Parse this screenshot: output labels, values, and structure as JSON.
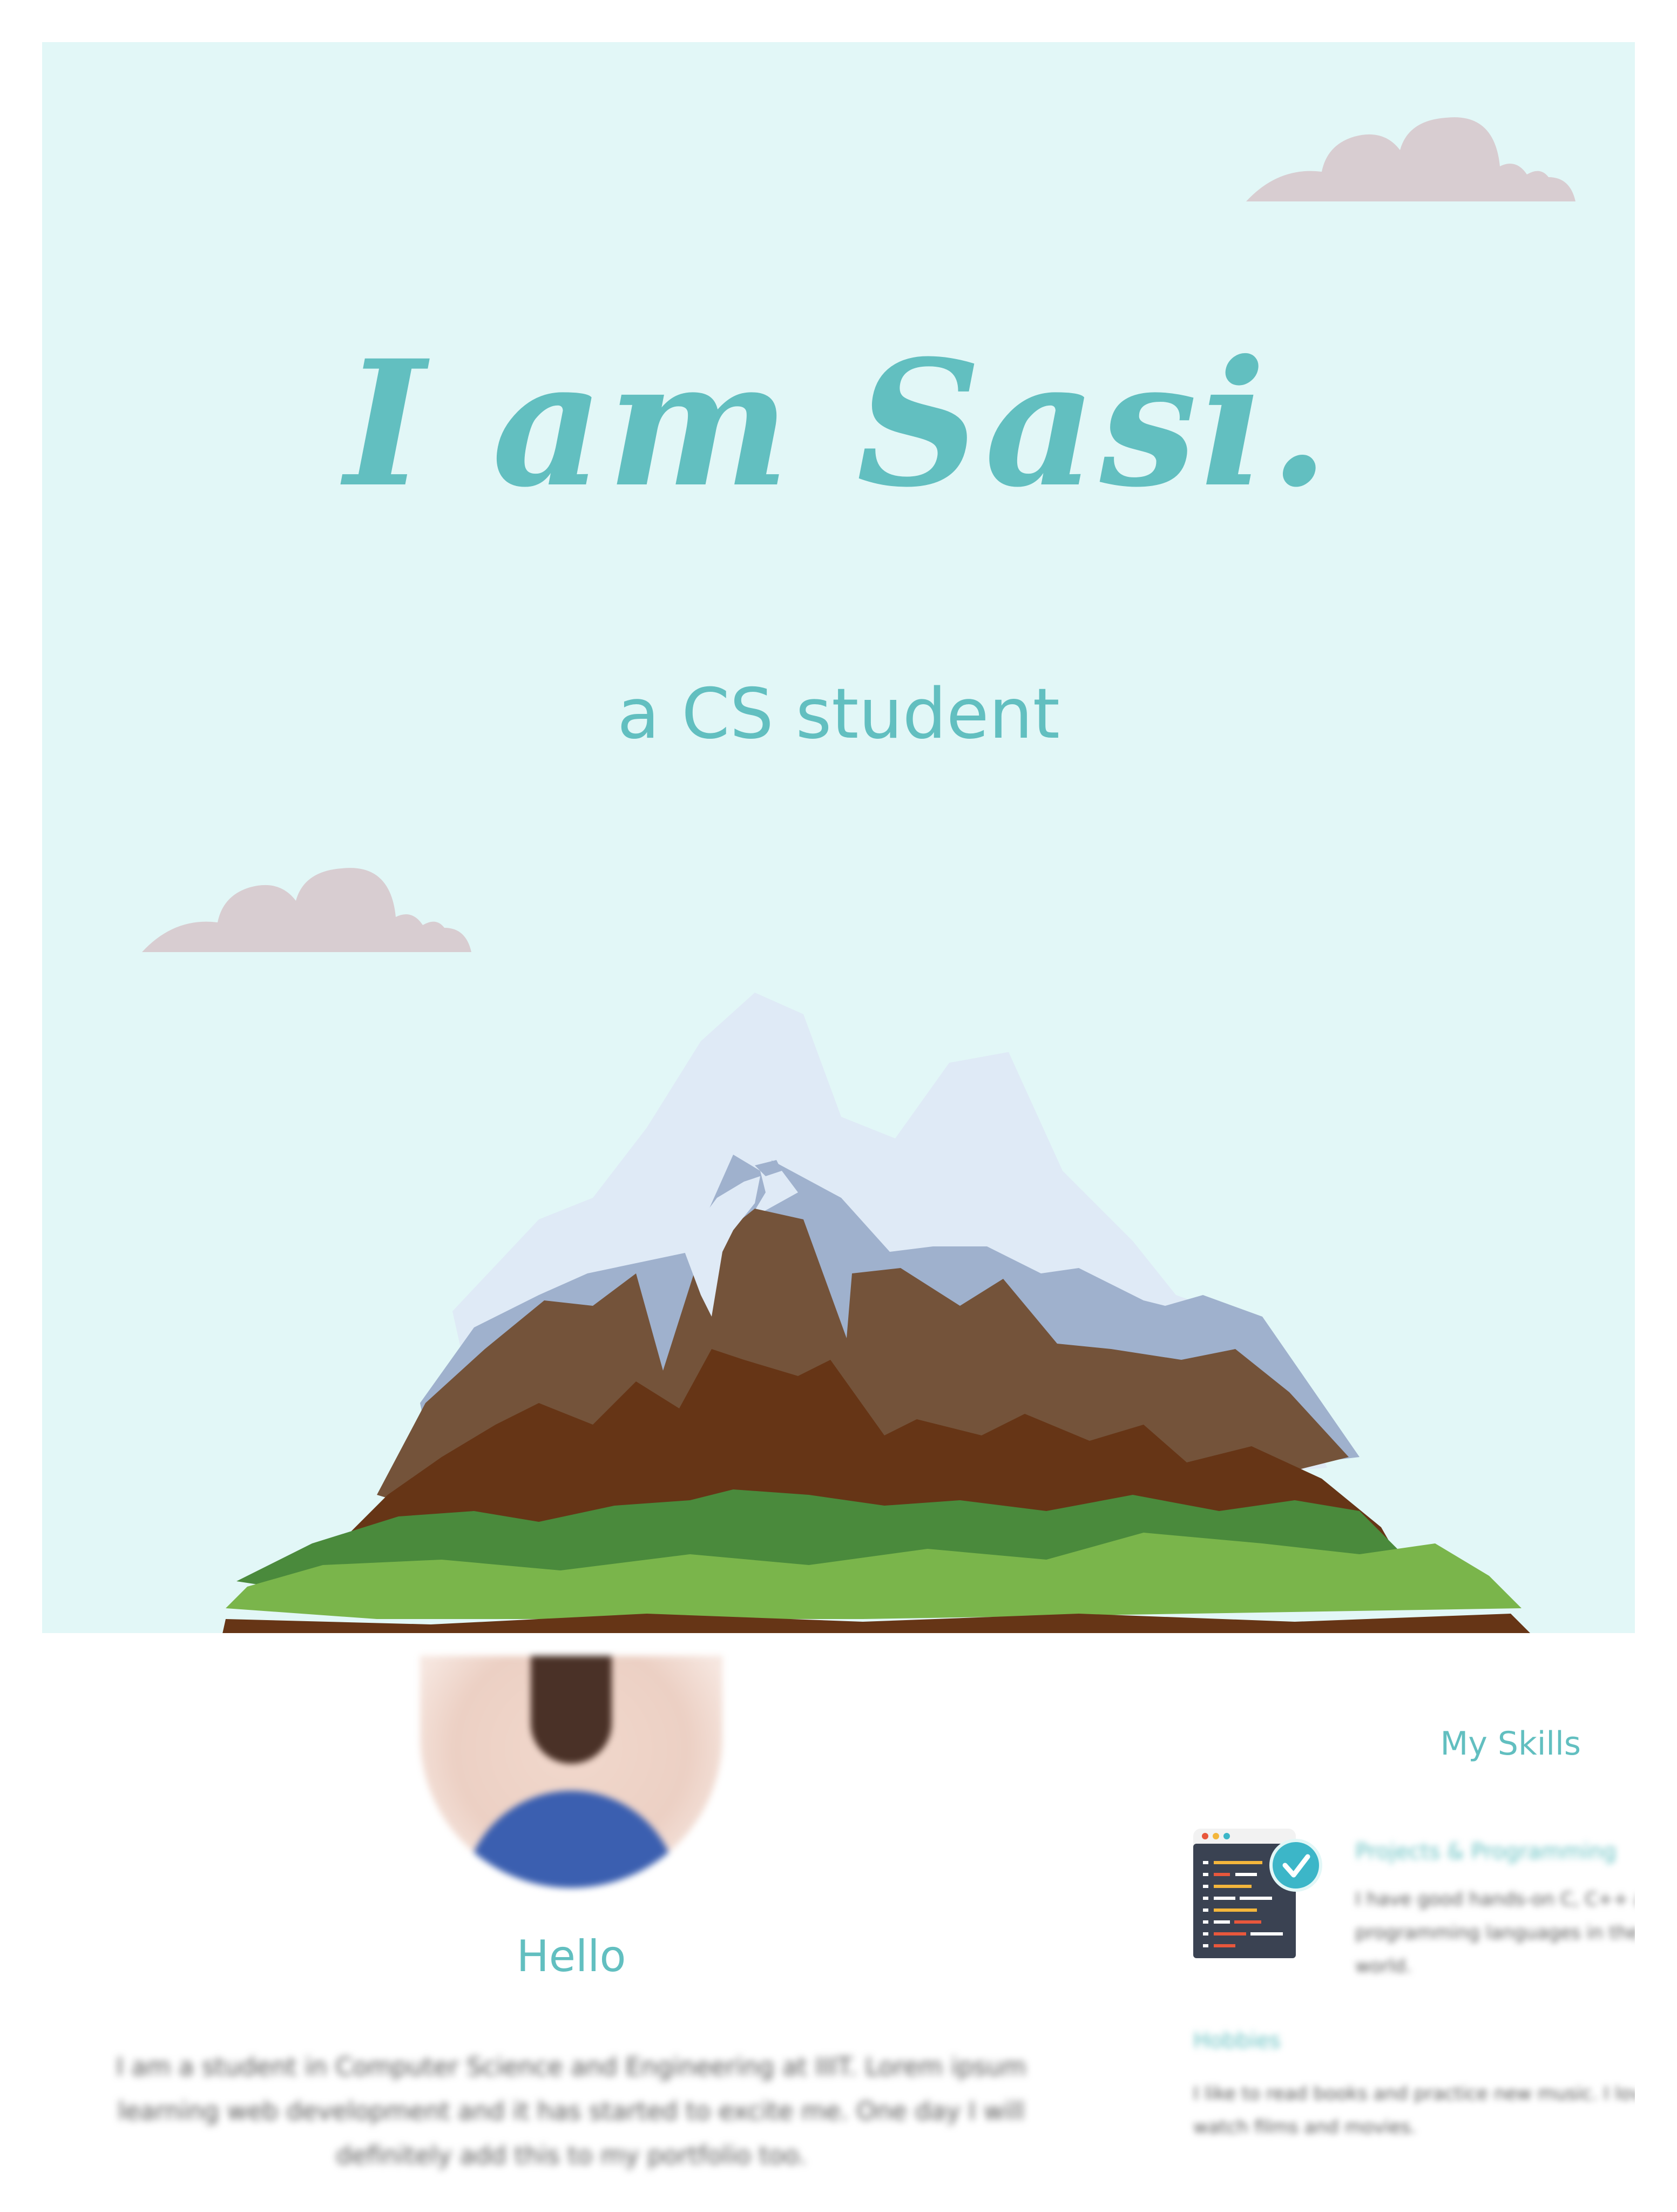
{
  "hero": {
    "title": "I am Sasi.",
    "subtitle": "a CS student",
    "background_color": "#e2f7f7",
    "accent_color": "#62bfc0"
  },
  "about": {
    "heading": "Hello",
    "text": "I am a student in Computer Science and Engineering at IIIT. Lorem ipsum learning web development and it has started to excite me. One day I will definitely add this to my portfolio too."
  },
  "skills": {
    "heading": "My Skills",
    "items": [
      {
        "name": "Projects & Programming",
        "description": "I have good hands-on C, C++ and Java programming languages in the digital world.",
        "icon": "code-window-check-icon"
      },
      {
        "name": "Hobbies",
        "description": "I like to read books and practice new music. I love to watch films and movies."
      }
    ]
  },
  "colors": {
    "cloud": "#d8cdd1",
    "snow": "#dfeaf6",
    "rock_shadow": "#9fb1cd",
    "brown_light": "#74533a",
    "brown_dark": "#663516",
    "grass_dark": "#4a8a3c",
    "grass_light": "#7ab54b"
  }
}
